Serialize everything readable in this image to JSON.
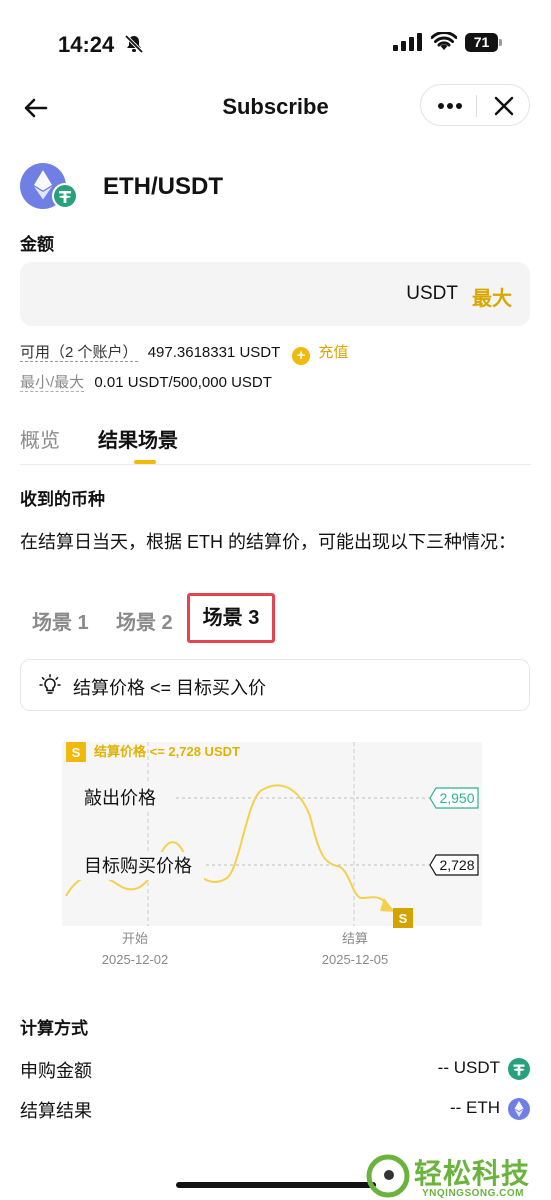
{
  "status_bar": {
    "time": "14:24",
    "battery": "71"
  },
  "nav": {
    "title": "Subscribe"
  },
  "product": {
    "pair": "ETH/USDT"
  },
  "amount": {
    "label": "金额",
    "unit": "USDT",
    "max": "最大"
  },
  "available": {
    "label": "可用（2 个账户）",
    "value": "497.3618331 USDT",
    "recharge": "充值"
  },
  "limits": {
    "label": "最小/最大",
    "value": "0.01 USDT/500,000 USDT"
  },
  "tabs": [
    {
      "label": "概览",
      "active": false
    },
    {
      "label": "结果场景",
      "active": true
    }
  ],
  "currency_section": {
    "title": "收到的币种",
    "description": "在结算日当天，根据 ETH 的结算价，可能出现以下三种情况："
  },
  "scenarios": [
    {
      "label": "场景 1",
      "active": false
    },
    {
      "label": "场景 2",
      "active": false
    },
    {
      "label": "场景 3",
      "active": true
    }
  ],
  "hint": {
    "text": "结算价格 <= 目标买入价"
  },
  "chart_data": {
    "type": "line",
    "badge": "S",
    "settle_text": "结算价格 <= 2,728 USDT",
    "lines": [
      {
        "name": "敲出价格",
        "value": 2950,
        "label": "2,950",
        "color": "#2db38a"
      },
      {
        "name": "目标购买价格",
        "value": 2728,
        "label": "2,728",
        "color": "#121212"
      }
    ],
    "x_markers": [
      {
        "name": "开始",
        "date": "2025-12-02"
      },
      {
        "name": "结算",
        "date": "2025-12-05"
      }
    ],
    "line_color": "#f5d04d",
    "end_marker": "S"
  },
  "calculation": {
    "title": "计算方式",
    "rows": [
      {
        "label": "申购金额",
        "value": "-- USDT",
        "coin": "usdt"
      },
      {
        "label": "结算结果",
        "value": "-- ETH",
        "coin": "eth"
      }
    ]
  },
  "watermark": {
    "text": "轻松科技",
    "sub": "YNQINGSONG.COM"
  }
}
